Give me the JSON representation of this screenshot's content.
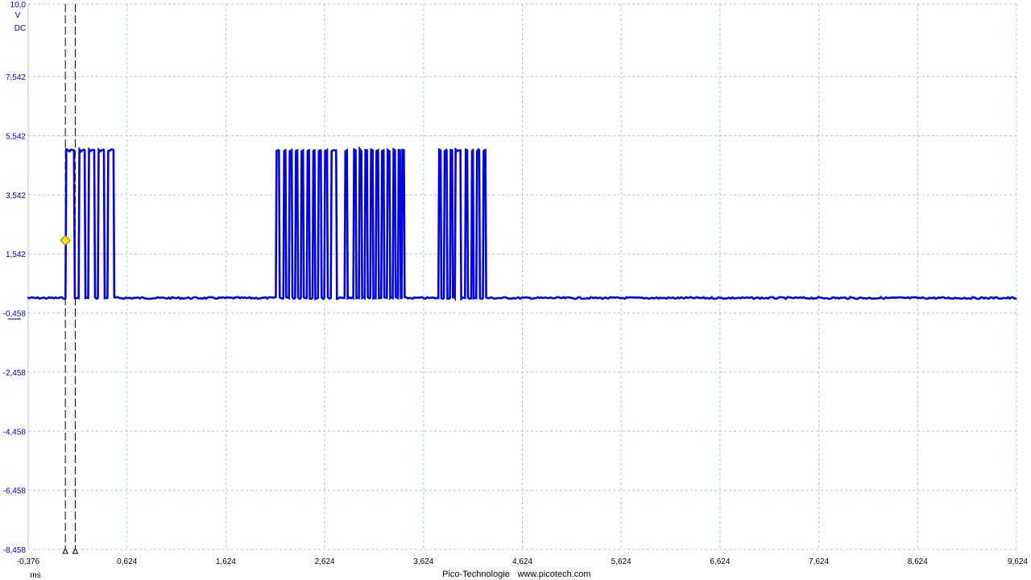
{
  "chart_data": {
    "type": "line",
    "title": "",
    "ylabel": "V",
    "coupling": "DC",
    "xlabel": "ms",
    "xlim": [
      -0.376,
      9.624
    ],
    "ylim": [
      -8.458,
      10.0
    ],
    "x_ticks": [
      "-0,376",
      "0,624",
      "1,624",
      "2,624",
      "3,624",
      "4,624",
      "5,624",
      "6,624",
      "7,624",
      "8,624",
      "9,624"
    ],
    "y_ticks": [
      {
        "label": "10,0",
        "value": 10.0
      },
      {
        "label": "7,542",
        "value": 7.542
      },
      {
        "label": "5,542",
        "value": 5.542
      },
      {
        "label": "3,542",
        "value": 3.542
      },
      {
        "label": "1,542",
        "value": 1.542
      },
      {
        "label": "-0,458",
        "value": -0.458
      },
      {
        "label": "-2,458",
        "value": -2.458
      },
      {
        "label": "-4,458",
        "value": -4.458
      },
      {
        "label": "-6,458",
        "value": -6.458
      },
      {
        "label": "-8,458",
        "value": -8.458
      }
    ],
    "grid": true,
    "series_color": "#0000ee",
    "low_level": 0.05,
    "high_level": 5.05,
    "pulses": [
      [
        0.001,
        0.088
      ],
      [
        0.134,
        0.195
      ],
      [
        0.231,
        0.292
      ],
      [
        0.329,
        0.39
      ],
      [
        0.426,
        0.487
      ],
      [
        2.129,
        2.161
      ],
      [
        2.206,
        2.227
      ],
      [
        2.262,
        2.29
      ],
      [
        2.325,
        2.347
      ],
      [
        2.383,
        2.405
      ],
      [
        2.443,
        2.465
      ],
      [
        2.501,
        2.521
      ],
      [
        2.556,
        2.585
      ],
      [
        2.62,
        2.648
      ],
      [
        2.686,
        2.74
      ],
      [
        2.825,
        2.849
      ],
      [
        2.913,
        2.937
      ],
      [
        2.97,
        2.995
      ],
      [
        3.028,
        3.052
      ],
      [
        3.085,
        3.109
      ],
      [
        3.14,
        3.164
      ],
      [
        3.196,
        3.22
      ],
      [
        3.253,
        3.279
      ],
      [
        3.313,
        3.335
      ],
      [
        3.365,
        3.386
      ],
      [
        3.402,
        3.425
      ],
      [
        3.774,
        3.797
      ],
      [
        3.83,
        3.858
      ],
      [
        3.891,
        3.913
      ],
      [
        3.941,
        3.997
      ],
      [
        4.044,
        4.066
      ],
      [
        4.107,
        4.124
      ],
      [
        4.158,
        4.187
      ],
      [
        4.225,
        4.25
      ]
    ],
    "trigger": {
      "time": 0.0,
      "level": 2.0,
      "color": "#ffe400"
    },
    "cursors": [
      0.0,
      0.1
    ]
  },
  "footer": {
    "brand": "Pico-Technologie",
    "url": "www.picotech.com"
  },
  "colors": {
    "axis_text": "#0000cc",
    "grid": "#a8c8e8",
    "cursor": "#000000"
  }
}
